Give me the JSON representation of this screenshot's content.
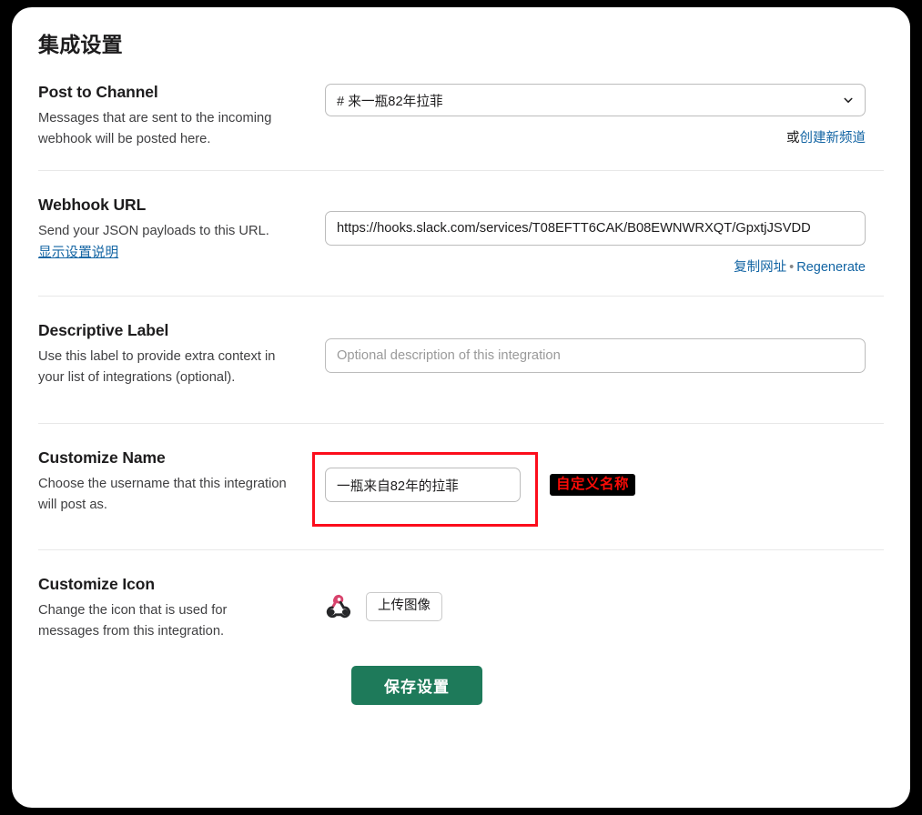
{
  "page": {
    "title": "集成设置"
  },
  "sections": {
    "post_to_channel": {
      "title": "Post to Channel",
      "description": "Messages that are sent to the incoming webhook will be posted here.",
      "select_value": "# 来一瓶82年拉菲",
      "chevron_icon": "chevron-down-icon",
      "helper_prefix": "或",
      "helper_link": "创建新频道"
    },
    "webhook_url": {
      "title": "Webhook URL",
      "description": "Send your JSON payloads to this URL.",
      "help_link": "显示设置说明",
      "value": "https://hooks.slack.com/services/T08EFTT6CAK/B08EWNWRXQT/GpxtjJSVDD",
      "copy_link": "复制网址",
      "separator": "•",
      "regenerate_link": "Regenerate"
    },
    "descriptive_label": {
      "title": "Descriptive Label",
      "description": "Use this label to provide extra context in your list of integrations (optional).",
      "value": "",
      "placeholder": "Optional description of this integration"
    },
    "customize_name": {
      "title": "Customize Name",
      "description": "Choose the username that this integration will post as.",
      "value": "一瓶来自82年的拉菲",
      "annotation_badge": "自定义名称",
      "highlight_color": "#fc0d1c",
      "badge_bg": "#000000",
      "badge_fg": "#f90b07"
    },
    "customize_icon": {
      "title": "Customize Icon",
      "description": "Change the icon that is used for messages from this integration.",
      "icon_name": "webhook-icon",
      "upload_label": "上传图像"
    }
  },
  "footer": {
    "save_label": "保存设置",
    "save_color": "#1e7a5a"
  },
  "colors": {
    "link": "#1264a3",
    "text": "#1d1c1d",
    "muted": "#3f3f41",
    "border": "#bcbcbc",
    "divider": "#e8e8e8"
  }
}
